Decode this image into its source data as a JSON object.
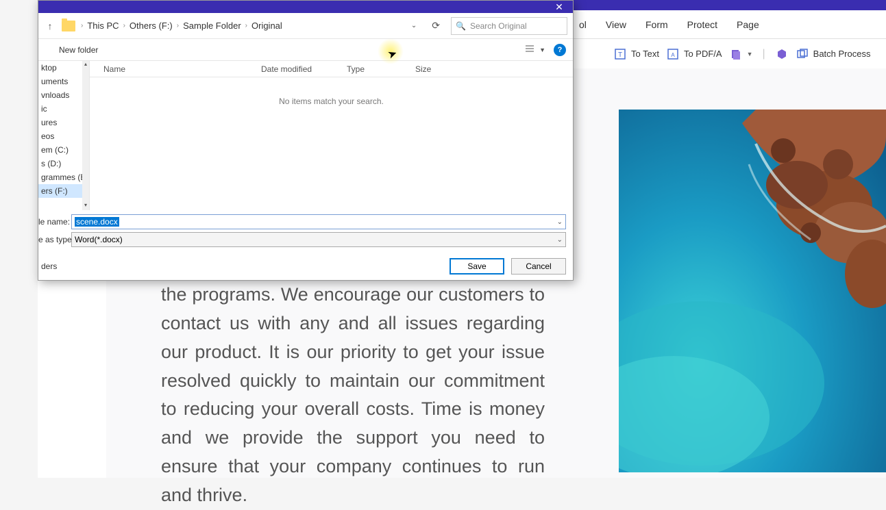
{
  "app": {
    "menus": {
      "view": "View",
      "form": "Form",
      "protect": "Protect",
      "page": "Page",
      "tool_suffix": "ol"
    },
    "toolbar": {
      "to_text": "To Text",
      "to_pdfa": "To PDF/A",
      "batch": "Batch Process"
    },
    "document_text": "the programs. We encourage our customers to contact us with any and all issues regarding our product. It is our priority to get your issue resolved quickly to maintain our commitment to reducing your overall costs. Time is money and we provide the support you need to ensure that your company continues to run and thrive."
  },
  "dialog": {
    "breadcrumbs": [
      "This PC",
      "Others (F:)",
      "Sample Folder",
      "Original"
    ],
    "search_placeholder": "Search Original",
    "new_folder": "New folder",
    "columns": {
      "name": "Name",
      "date": "Date modified",
      "type": "Type",
      "size": "Size"
    },
    "empty": "No items match your search.",
    "sidebar_items": [
      "ktop",
      "uments",
      "vnloads",
      "ic",
      "ures",
      "eos",
      "em (C:)",
      "s (D:)",
      "grammes (E:)",
      "ers (F:)"
    ],
    "filename_label": "le name:",
    "filetype_label": "e as type:",
    "filename_value": "scene.docx",
    "filetype_value": "Word(*.docx)",
    "hide_folders": "ders",
    "save": "Save",
    "cancel": "Cancel"
  }
}
